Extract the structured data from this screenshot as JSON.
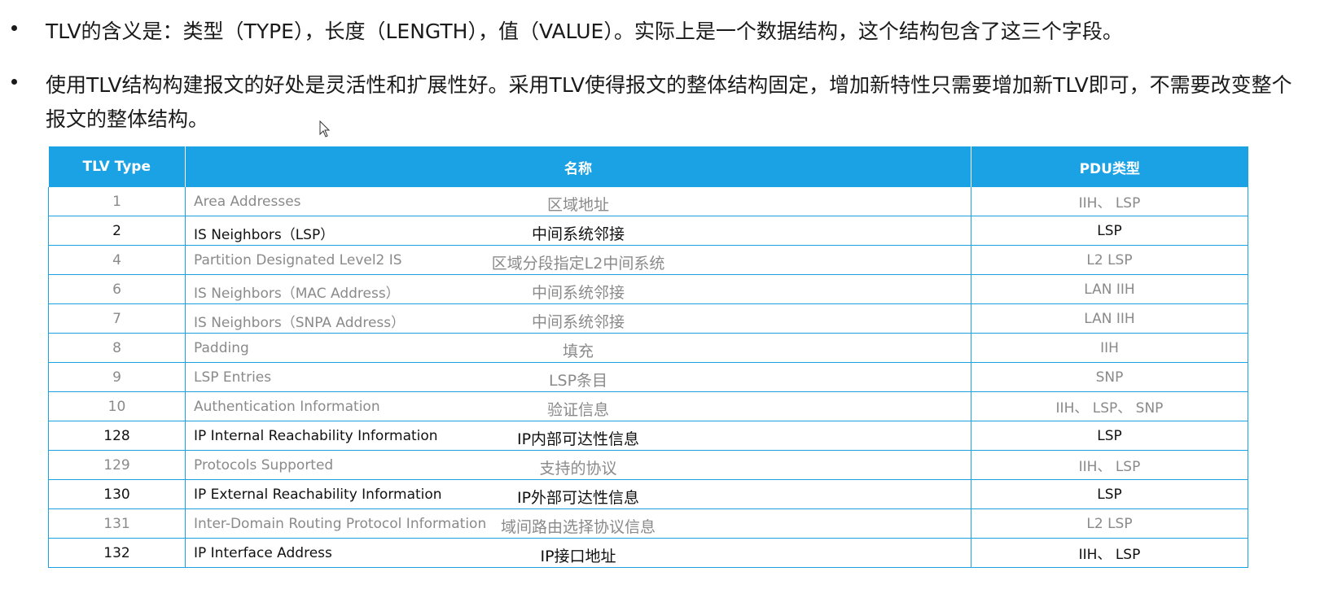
{
  "bullets": [
    "TLV的含义是：类型（TYPE），长度（LENGTH），值（VALUE）。实际上是一个数据结构，这个结构包含了这三个字段。",
    "使用TLV结构构建报文的好处是灵活性和扩展性好。采用TLV使得报文的整体结构固定，增加新特性只需要增加新TLV即可，不需要改变整个报文的整体结构。"
  ],
  "table": {
    "headers": [
      "TLV Type",
      "名称",
      "PDU类型"
    ],
    "rows": [
      {
        "type": "1",
        "en": "Area Addresses",
        "cn": "区域地址",
        "pdu": "IIH、 LSP",
        "strong": false
      },
      {
        "type": "2",
        "en": "IS Neighbors（LSP）",
        "cn": "中间系统邻接",
        "pdu": "LSP",
        "strong": true
      },
      {
        "type": "4",
        "en": "Partition Designated Level2 IS",
        "cn": "区域分段指定L2中间系统",
        "pdu": "L2 LSP",
        "strong": false
      },
      {
        "type": "6",
        "en": "IS Neighbors（MAC Address）",
        "cn": "中间系统邻接",
        "pdu": "LAN IIH",
        "strong": false
      },
      {
        "type": "7",
        "en": "IS Neighbors（SNPA Address）",
        "cn": "中间系统邻接",
        "pdu": "LAN IIH",
        "strong": false
      },
      {
        "type": "8",
        "en": "Padding",
        "cn": "填充",
        "pdu": "IIH",
        "strong": false
      },
      {
        "type": "9",
        "en": "LSP Entries",
        "cn": "LSP条目",
        "pdu": "SNP",
        "strong": false
      },
      {
        "type": "10",
        "en": "Authentication Information",
        "cn": "验证信息",
        "pdu": "IIH、 LSP、 SNP",
        "strong": false
      },
      {
        "type": "128",
        "en": "IP Internal Reachability Information",
        "cn": "IP内部可达性信息",
        "pdu": "LSP",
        "strong": true
      },
      {
        "type": "129",
        "en": "Protocols Supported",
        "cn": "支持的协议",
        "pdu": "IIH、 LSP",
        "strong": false
      },
      {
        "type": "130",
        "en": "IP External Reachability Information",
        "cn": "IP外部可达性信息",
        "pdu": "LSP",
        "strong": true
      },
      {
        "type": "131",
        "en": "Inter-Domain Routing Protocol Information",
        "cn": "域间路由选择协议信息",
        "pdu": "L2 LSP",
        "strong": false
      },
      {
        "type": "132",
        "en": "IP Interface Address",
        "cn": "IP接口地址",
        "pdu": "IIH、 LSP",
        "strong": true
      }
    ]
  },
  "colors": {
    "header_bg": "#1ba2e4",
    "border": "#1ba2e4",
    "dim_text": "#8a8a8a",
    "strong_text": "#111111"
  }
}
